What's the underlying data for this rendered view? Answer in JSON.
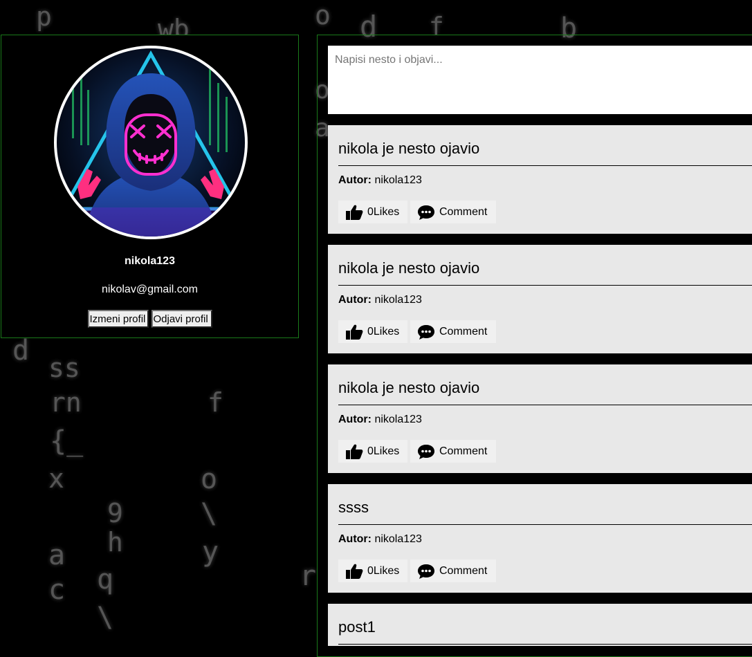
{
  "profile": {
    "username": "nikola123",
    "email": "nikolav@gmail.com",
    "edit_label": "Izmeni profil",
    "logout_label": "Odjavi profil"
  },
  "composer": {
    "placeholder": "Napisi nesto i objavi..."
  },
  "posts": [
    {
      "title": "nikola je nesto ojavio",
      "author_label": "Autor:",
      "author": "nikola123",
      "likes": "0Likes",
      "comment_label": "Comment"
    },
    {
      "title": "nikola je nesto ojavio",
      "author_label": "Autor:",
      "author": "nikola123",
      "likes": "0Likes",
      "comment_label": "Comment"
    },
    {
      "title": "nikola je nesto ojavio",
      "author_label": "Autor:",
      "author": "nikola123",
      "likes": "0Likes",
      "comment_label": "Comment"
    },
    {
      "title": "ssss",
      "author_label": "Autor:",
      "author": "nikola123",
      "likes": "0Likes",
      "comment_label": "Comment"
    },
    {
      "title": "post1"
    }
  ],
  "icons": {
    "like": "thumbs-up-icon",
    "comment": "comment-icon"
  },
  "colors": {
    "panel_border": "#1a7a1a",
    "post_bg": "#e8e8e8",
    "avatar_neon_pink": "#ff2fd0",
    "avatar_neon_cyan": "#29d7ff"
  }
}
